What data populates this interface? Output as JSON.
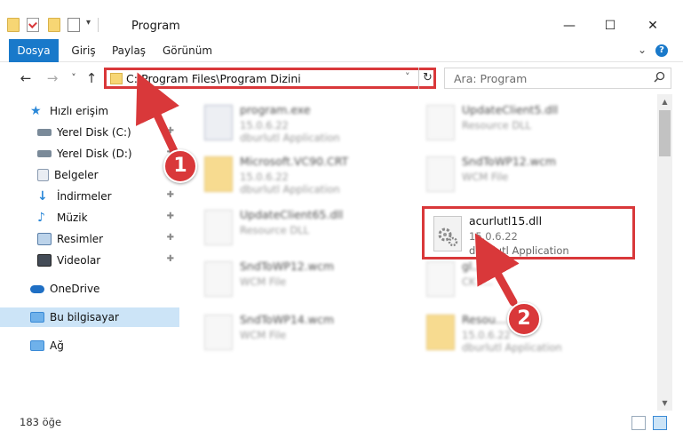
{
  "window": {
    "title": "Program",
    "controls": {
      "minimize": "—",
      "maximize": "☐",
      "close": "✕"
    }
  },
  "ribbon": {
    "tabs": [
      {
        "label": "Dosya",
        "active": true
      },
      {
        "label": "Giriş"
      },
      {
        "label": "Paylaş"
      },
      {
        "label": "Görünüm"
      }
    ],
    "help": "?",
    "expand": "⌄"
  },
  "navigation": {
    "back": "←",
    "forward": "→",
    "recent": "˅",
    "up": "↑"
  },
  "address": {
    "path": "C:\\Program Files\\Program Dizini",
    "dropdown": "˅",
    "refresh": "↻"
  },
  "search": {
    "placeholder": "Ara: Program",
    "icon": "search-icon"
  },
  "sidebar": {
    "items": [
      {
        "label": "Hızlı erişim",
        "icon": "star-icon",
        "color": "#2b88d8",
        "pinned": false
      },
      {
        "label": "Yerel Disk (C:)",
        "icon": "drive-icon",
        "color": "#7a8a99",
        "pinned": true
      },
      {
        "label": "Yerel Disk (D:)",
        "icon": "drive-icon",
        "color": "#7a8a99",
        "pinned": true
      },
      {
        "label": "Belgeler",
        "icon": "documents-icon",
        "color": "#8a9bb0",
        "pinned": true
      },
      {
        "label": "İndirmeler",
        "icon": "download-icon",
        "color": "#2b88d8",
        "pinned": true
      },
      {
        "label": "Müzik",
        "icon": "music-icon",
        "color": "#2b88d8",
        "pinned": true
      },
      {
        "label": "Resimler",
        "icon": "pictures-icon",
        "color": "#5a7fa8",
        "pinned": true
      },
      {
        "label": "Videolar",
        "icon": "videos-icon",
        "color": "#444c57",
        "pinned": true
      },
      {
        "label": "OneDrive",
        "icon": "cloud-icon",
        "color": "#1f6fc4",
        "pinned": false
      },
      {
        "label": "Bu bilgisayar",
        "icon": "computer-icon",
        "color": "#3a8ad6",
        "pinned": false,
        "selected": true
      },
      {
        "label": "Ağ",
        "icon": "network-icon",
        "color": "#3a8ad6",
        "pinned": false
      }
    ],
    "pin_glyph": "📌"
  },
  "files": [
    {
      "name": "program.exe",
      "line1": "15.0.6.22",
      "line2": "dburlutl Application",
      "kind": "exe"
    },
    {
      "name": "UpdateClient5.dll",
      "line1": "Resource DLL",
      "line2": "",
      "kind": "dll"
    },
    {
      "name": "Microsoft.VC90.CRT",
      "line1": "15.0.6.22",
      "line2": "dburlutl Application",
      "kind": "folder"
    },
    {
      "name": "SndToWP12.wcm",
      "line1": "WCM File",
      "line2": "",
      "kind": "file"
    },
    {
      "name": "UpdateClient65.dll",
      "line1": "Resource DLL",
      "line2": "",
      "kind": "dll"
    },
    {
      "name": "SndToWP12.wcm",
      "line1": "WCM File",
      "line2": "",
      "kind": "file"
    },
    {
      "name": "gl...",
      "line1": "CK F...",
      "line2": "",
      "kind": "file"
    },
    {
      "name": "SndToWP14.wcm",
      "line1": "WCM File",
      "line2": "",
      "kind": "file"
    },
    {
      "name": "Resou...",
      "line1": "15.0.6.22",
      "line2": "dburlutl Application",
      "kind": "folder"
    }
  ],
  "highlighted_file": {
    "name": "acurlutl15.dll",
    "line1": "15.0.6.22",
    "line2": "dburlutl Application"
  },
  "status": {
    "count": "183 öğe"
  },
  "annotations": {
    "step1": "1",
    "step2": "2",
    "color": "#d9383a"
  }
}
